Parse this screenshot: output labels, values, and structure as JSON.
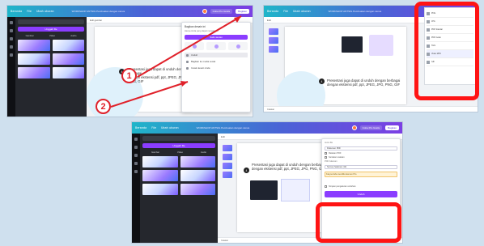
{
  "topbar": {
    "home": "Beranda",
    "file": "File",
    "resize": "Ubah ukuran",
    "doc_title": "WORKSHOP ANTSIG Pembuatan dengan canva",
    "upgrade": "Coba Pro Gratis",
    "share": "Bagikan"
  },
  "drawer": {
    "primary_button": "Unggah file",
    "tabs": [
      "Gambar",
      "Video",
      "Audio"
    ]
  },
  "canvas": {
    "caption_line1": "Presentasi juga dapat di unduh dengan berbagai",
    "caption_line2": "dengan ekstensi pdf, ppt, JPEG, JPG, PNG, GIF"
  },
  "share_menu": {
    "title": "Bagikan desain ini",
    "subtitle": "Hanya Anda yang dapat mengakses",
    "primary_button": "Salin tautan",
    "rows": [
      "Unduh",
      "Bagikan ke media sosial",
      "Cetak desain Anda"
    ]
  },
  "download_menu": {
    "filetype_label": "Jenis file",
    "filetype_value": "Dokumen PDF",
    "option1": "Ratakan PDF",
    "option2": "Sertakan catatan",
    "pages_label": "Pilih halaman",
    "pages_value": "Semua halaman (12)",
    "notice": "Karya Anda memiliki elemen Pro",
    "save_settings": "Simpan pengaturan unduhan",
    "download_button": "Unduh"
  },
  "filetypes": [
    "PNG",
    "JPG",
    "PDF Standar",
    "PDF Cetak",
    "SVG",
    "Video MP4",
    "GIF"
  ],
  "bottombar": {
    "notes": "Catatan"
  },
  "annotations": {
    "step1": "1",
    "step2": "2"
  },
  "colors": {
    "accent": "#8b3dff",
    "highlight": "#ff1414",
    "header_start": "#1fb5c9",
    "header_end": "#7b3fe4"
  }
}
